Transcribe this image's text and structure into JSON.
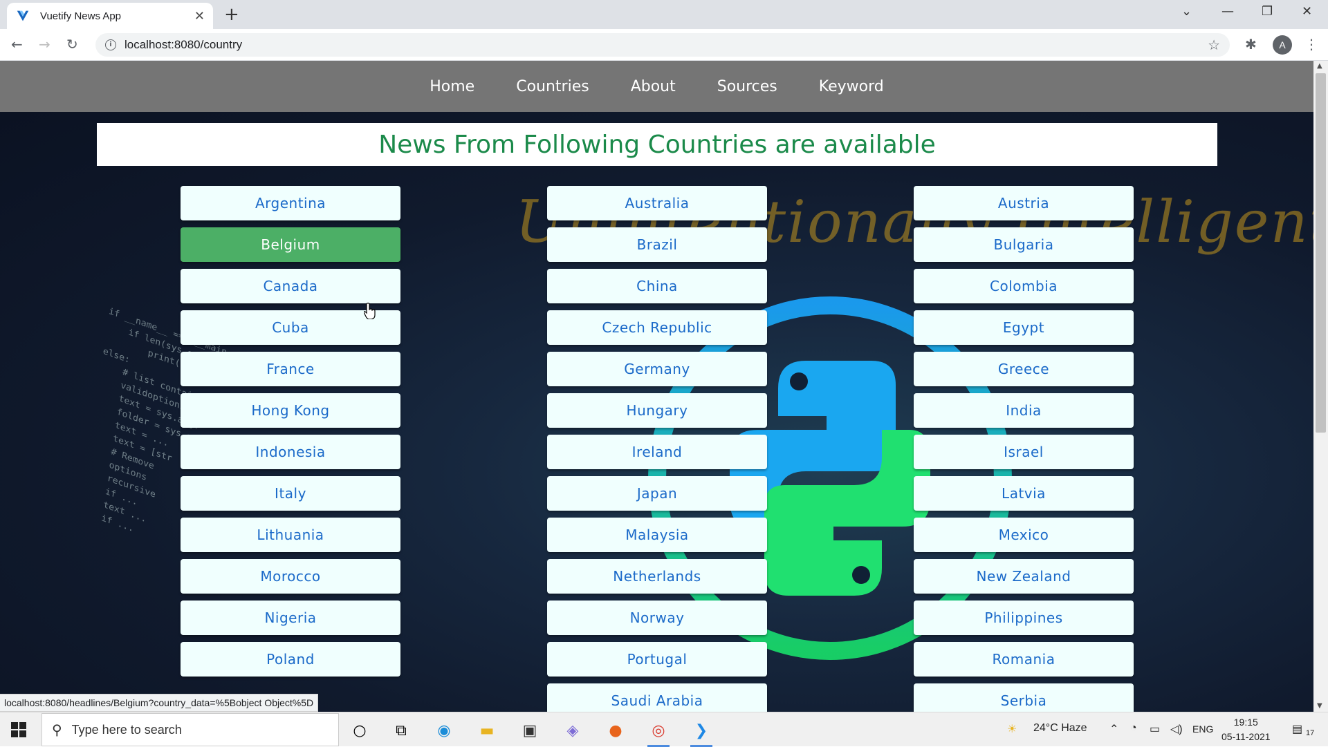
{
  "browser": {
    "tab_title": "Vuetify News App",
    "url": "localhost:8080/country",
    "profile_initial": "A",
    "status_url": "localhost:8080/headlines/Belgium?country_data=%5Bobject Object%5D"
  },
  "nav": {
    "links": [
      "Home",
      "Countries",
      "About",
      "Sources",
      "Keyword"
    ]
  },
  "page": {
    "heading": "News From Following Countries are available",
    "watermark": "Unintentionally Intelligent",
    "active_country": "Belgium",
    "columns": [
      [
        "Argentina",
        "Belgium",
        "Canada",
        "Cuba",
        "France",
        "Hong Kong",
        "Indonesia",
        "Italy",
        "Lithuania",
        "Morocco",
        "Nigeria",
        "Poland"
      ],
      [
        "Australia",
        "Brazil",
        "China",
        "Czech Republic",
        "Germany",
        "Hungary",
        "Ireland",
        "Japan",
        "Malaysia",
        "Netherlands",
        "Norway",
        "Portugal",
        "Saudi Arabia"
      ],
      [
        "Austria",
        "Bulgaria",
        "Colombia",
        "Egypt",
        "Greece",
        "India",
        "Israel",
        "Latvia",
        "Mexico",
        "New Zealand",
        "Philippines",
        "Romania",
        "Serbia"
      ]
    ]
  },
  "taskbar": {
    "search_placeholder": "Type here to search",
    "weather": "24°C  Haze",
    "language": "ENG",
    "time": "19:15",
    "date": "05-11-2021",
    "notification_count": "17"
  },
  "colors": {
    "appbar": "#757575",
    "heading_green": "#1b8a4a",
    "button_text": "#1b6ac9",
    "active_button": "#4caf66"
  }
}
